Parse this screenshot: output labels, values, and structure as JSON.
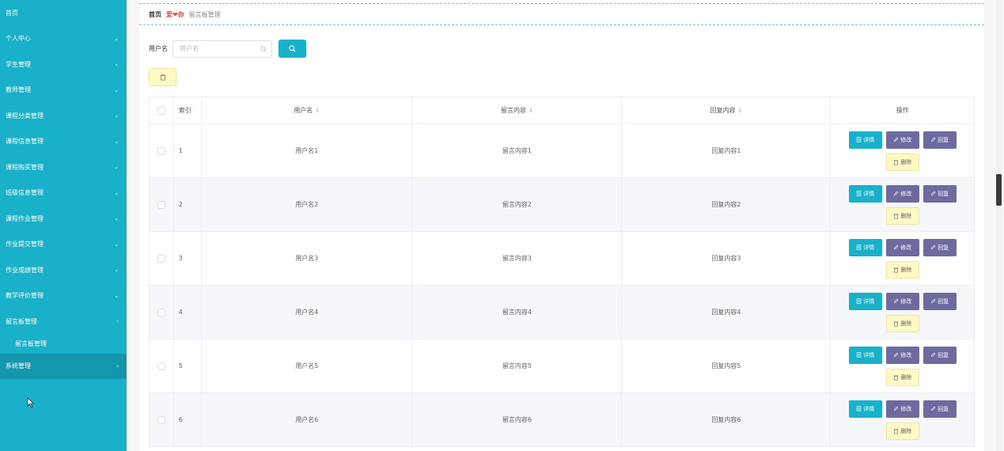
{
  "sidebar": {
    "items": [
      {
        "label": "首页",
        "chevron": ""
      },
      {
        "label": "个人中心",
        "chevron": "⌄"
      },
      {
        "label": "学生管理",
        "chevron": "⌄"
      },
      {
        "label": "教师管理",
        "chevron": "⌄"
      },
      {
        "label": "课程分类管理",
        "chevron": "⌄"
      },
      {
        "label": "课程信息管理",
        "chevron": "⌄"
      },
      {
        "label": "课程购买管理",
        "chevron": "⌄"
      },
      {
        "label": "班级信息管理",
        "chevron": "⌄"
      },
      {
        "label": "课程作业管理",
        "chevron": "⌄"
      },
      {
        "label": "作业提交管理",
        "chevron": "⌄"
      },
      {
        "label": "作业成绩管理",
        "chevron": "⌄"
      },
      {
        "label": "教学评价管理",
        "chevron": "⌄"
      },
      {
        "label": "留言板管理",
        "chevron": "‹"
      }
    ],
    "sub_item": {
      "label": "留言板管理"
    },
    "system": {
      "label": "系统管理",
      "chevron": "‹"
    }
  },
  "breadcrumb": {
    "home": "首页",
    "separator": "爱❤你",
    "current": "留言板管理"
  },
  "search": {
    "label": "用户名",
    "placeholder": "用户名",
    "value": ""
  },
  "table": {
    "headers": {
      "index": "索引",
      "username": "用户名",
      "message": "留言内容",
      "reply": "回复内容",
      "actions": "操作"
    },
    "rows": [
      {
        "index": "1",
        "username": "用户名1",
        "message": "留言内容1",
        "reply": "回复内容1"
      },
      {
        "index": "2",
        "username": "用户名2",
        "message": "留言内容2",
        "reply": "回复内容2"
      },
      {
        "index": "3",
        "username": "用户名3",
        "message": "留言内容3",
        "reply": "回复内容3"
      },
      {
        "index": "4",
        "username": "用户名4",
        "message": "留言内容4",
        "reply": "回复内容4"
      },
      {
        "index": "5",
        "username": "用户名5",
        "message": "留言内容5",
        "reply": "回复内容5"
      },
      {
        "index": "6",
        "username": "用户名6",
        "message": "留言内容6",
        "reply": "回复内容6"
      }
    ],
    "actions": {
      "detail": "详情",
      "edit": "修改",
      "reply": "回复",
      "delete": "删除"
    }
  },
  "colors": {
    "sidebar": "#18b1c9",
    "primary_button": "#18b1c9",
    "secondary_button": "#6c6a9e",
    "delete_button": "#fff9c4",
    "breadcrumb_separator": "#e0484b"
  },
  "icons": {
    "search_button": "search-icon",
    "bulk_delete": "trash-icon",
    "detail": "document-icon",
    "edit": "pencil-icon",
    "reply": "pencil-icon",
    "delete": "trash-icon",
    "sort": "sort-icon"
  }
}
